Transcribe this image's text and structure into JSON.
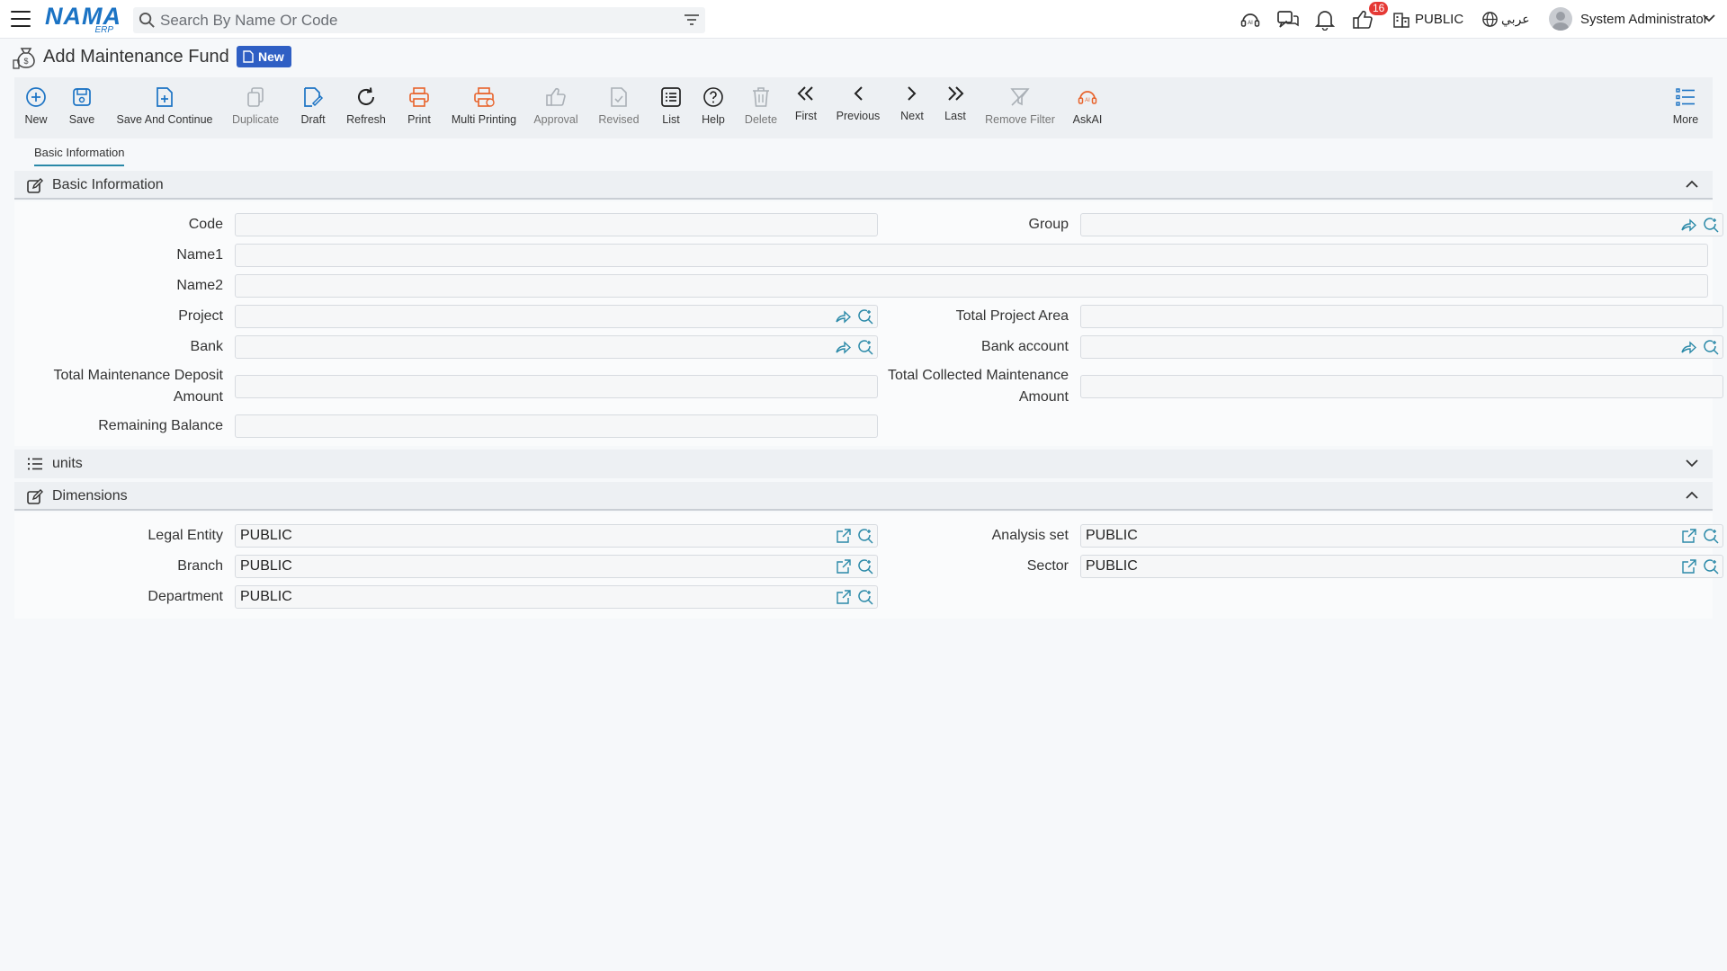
{
  "topbar": {
    "logo_text": "NAMA",
    "logo_sub": "ERP",
    "search_placeholder": "Search By Name Or Code",
    "notifications_count": "16",
    "company": "PUBLIC",
    "language": "عربي",
    "user_name": "System Administrator"
  },
  "page": {
    "title": "Add Maintenance Fund",
    "status_badge": "New"
  },
  "toolbar": {
    "new": "New",
    "save": "Save",
    "save_continue": "Save And Continue",
    "duplicate": "Duplicate",
    "draft": "Draft",
    "refresh": "Refresh",
    "print": "Print",
    "multi_printing": "Multi Printing",
    "approval": "Approval",
    "revised": "Revised",
    "list": "List",
    "help": "Help",
    "delete": "Delete",
    "first": "First",
    "previous": "Previous",
    "next": "Next",
    "last": "Last",
    "remove_filter": "Remove Filter",
    "askai": "AskAI",
    "more": "More"
  },
  "tabs": [
    "Basic Information"
  ],
  "sections": {
    "basic": {
      "title": "Basic Information",
      "fields": {
        "code": {
          "label": "Code",
          "value": ""
        },
        "group": {
          "label": "Group",
          "value": ""
        },
        "name1": {
          "label": "Name1",
          "value": ""
        },
        "name2": {
          "label": "Name2",
          "value": ""
        },
        "project": {
          "label": "Project",
          "value": ""
        },
        "total_project_area": {
          "label": "Total Project Area",
          "value": ""
        },
        "bank": {
          "label": "Bank",
          "value": ""
        },
        "bank_account": {
          "label": "Bank account",
          "value": ""
        },
        "total_deposit_1": "Total Maintenance Deposit",
        "total_deposit_2": "Amount",
        "total_deposit_value": "",
        "total_collected_1": "Total Collected Maintenance",
        "total_collected_2": "Amount",
        "total_collected_value": "",
        "remaining": {
          "label": "Remaining Balance",
          "value": ""
        }
      }
    },
    "units": {
      "title": "units"
    },
    "dimensions": {
      "title": "Dimensions",
      "fields": {
        "legal_entity": {
          "label": "Legal Entity",
          "value": "PUBLIC"
        },
        "analysis_set": {
          "label": "Analysis set",
          "value": "PUBLIC"
        },
        "branch": {
          "label": "Branch",
          "value": "PUBLIC"
        },
        "sector": {
          "label": "Sector",
          "value": "PUBLIC"
        },
        "department": {
          "label": "Department",
          "value": "PUBLIC"
        }
      }
    }
  },
  "colors": {
    "accent": "#1b73c4",
    "print_orange": "#e8632b",
    "badge_blue": "#2f5fc4",
    "notification_red": "#e53935"
  }
}
